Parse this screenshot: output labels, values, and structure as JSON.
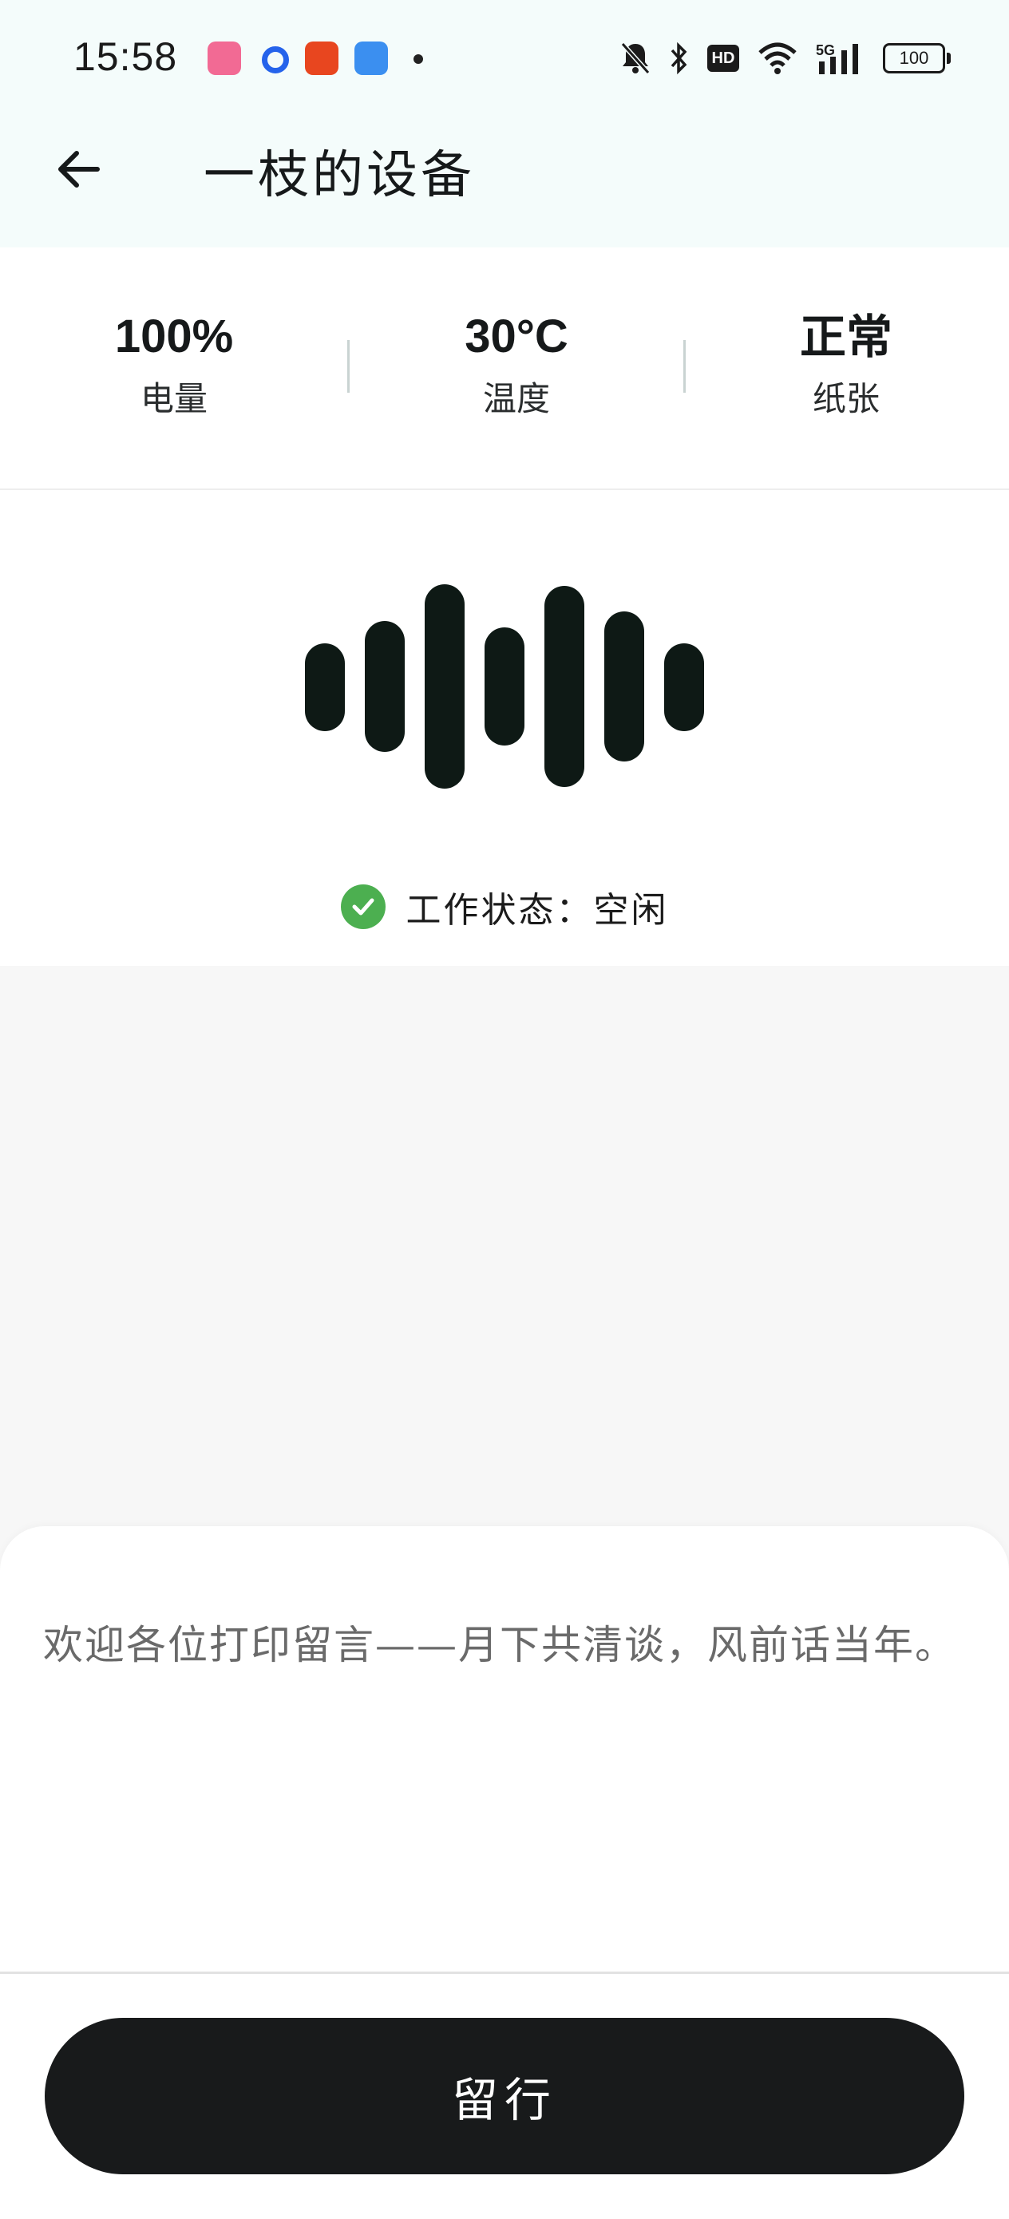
{
  "status_bar": {
    "time": "15:58",
    "battery_level": "100",
    "network": "5G",
    "hd_label": "HD"
  },
  "header": {
    "title": "一枝的设备",
    "back_icon": "arrow-left-icon"
  },
  "stats": {
    "battery": {
      "value": "100%",
      "label": "电量"
    },
    "temperature": {
      "value": "30°C",
      "label": "温度"
    },
    "paper": {
      "value": "正常",
      "label": "纸张"
    }
  },
  "device": {
    "status_text": "工作状态：空闲",
    "status_icon": "check-circle-icon",
    "status_color": "#4caf50",
    "wave_icon": "sound-wave-icon"
  },
  "message": {
    "placeholder": "欢迎各位打印留言——月下共清谈，风前话当年。",
    "submit_label": "留行"
  },
  "colors": {
    "header_bg": "#f4fcfb",
    "button_bg": "#181a1b",
    "wave_bar": "#0e1915"
  }
}
